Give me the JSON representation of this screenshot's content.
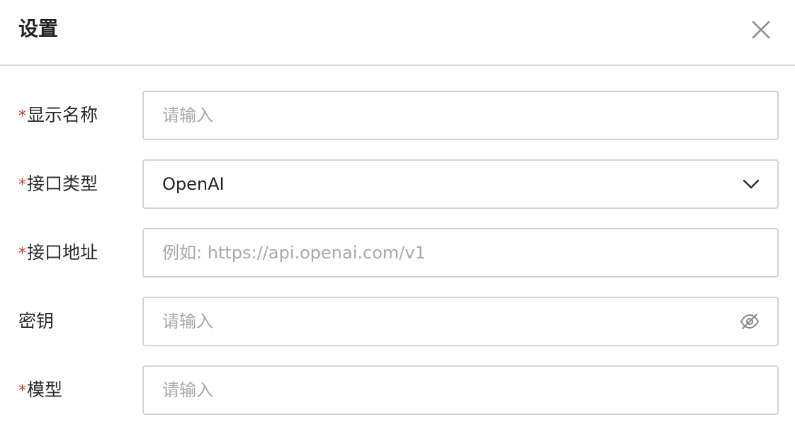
{
  "dialog": {
    "title": "设置",
    "close_icon": "close-icon"
  },
  "form": {
    "display_name": {
      "label": "显示名称",
      "required": true,
      "required_mark": "*",
      "placeholder": "请输入",
      "value": ""
    },
    "api_type": {
      "label": "接口类型",
      "required": true,
      "required_mark": "*",
      "selected": "OpenAI",
      "icon": "chevron-down-icon"
    },
    "api_url": {
      "label": "接口地址",
      "required": true,
      "required_mark": "*",
      "placeholder": "例如: https://api.openai.com/v1",
      "value": ""
    },
    "secret_key": {
      "label": "密钥",
      "required": false,
      "placeholder": "请输入",
      "value": "",
      "icon": "eye-off-icon"
    },
    "model": {
      "label": "模型",
      "required": true,
      "required_mark": "*",
      "placeholder": "请输入",
      "value": ""
    }
  },
  "colors": {
    "required": "#e0362c",
    "border": "#d3d3d3",
    "placeholder": "#a9a9a9",
    "divider": "#dcdcdc"
  }
}
